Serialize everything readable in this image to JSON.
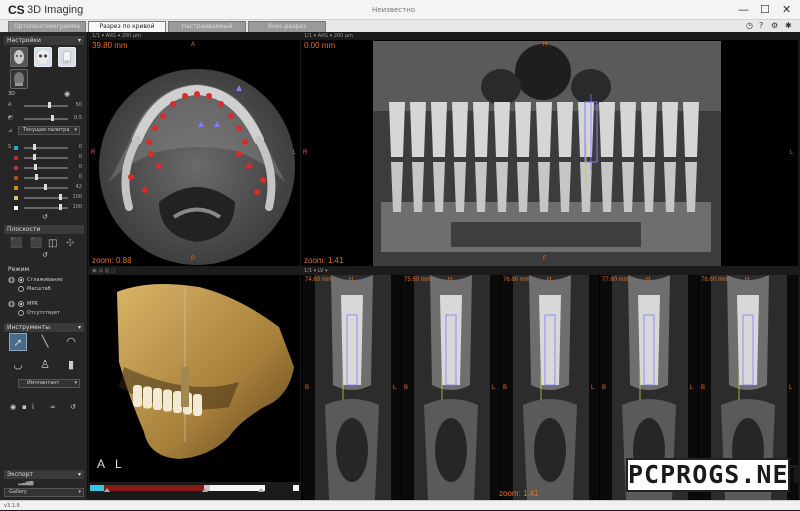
{
  "app": {
    "logo_bold": "CS",
    "logo_rest": "3D Imaging",
    "doc_title": "Неизвестно"
  },
  "window_controls": {
    "minimize": "—",
    "maximize": "☐",
    "close": "✕"
  },
  "tabs": [
    {
      "label": "Ортопантомограмма",
      "active": false
    },
    {
      "label": "Разрез по кривой",
      "active": true
    },
    {
      "label": "Настраиваемый толщиной",
      "active": false
    },
    {
      "label": "Вокс-разрез",
      "active": false
    }
  ],
  "toolbar_icons": [
    "clock-icon",
    "help-icon",
    "gears-icon",
    "settings-icon"
  ],
  "sidebar": {
    "settings_header": "Настройки",
    "preset_thumbs": [
      "head-front",
      "skull",
      "tooth",
      "head-dark"
    ],
    "sliders_main": [
      {
        "label": "3D",
        "value": "",
        "pos": 0.85,
        "color": ""
      },
      {
        "label": "A",
        "value": "50",
        "pos": 0.55,
        "color": ""
      },
      {
        "label": "",
        "value": "0.5",
        "pos": 0.62,
        "color": ""
      }
    ],
    "palette_label": "Текущая палитра",
    "sliders_palette": [
      {
        "label": "S",
        "value": "0",
        "pos": 0.2,
        "color": "#29a6d6"
      },
      {
        "label": "",
        "value": "0",
        "pos": 0.2,
        "color": "#b83030"
      },
      {
        "label": "",
        "value": "0",
        "pos": 0.22,
        "color": "#b83030"
      },
      {
        "label": "",
        "value": "0",
        "pos": 0.25,
        "color": "#b05020"
      },
      {
        "label": "",
        "value": "42",
        "pos": 0.45,
        "color": "#d08a20"
      },
      {
        "label": "",
        "value": "100",
        "pos": 0.8,
        "color": "#e0c070"
      },
      {
        "label": "",
        "value": "100",
        "pos": 0.8,
        "color": "#ffffff"
      }
    ],
    "views_header": "Плоскости",
    "mode_header": "Режим",
    "mode_options": [
      {
        "label": "Сглаживание",
        "on": true
      },
      {
        "label": "Масштаб",
        "on": false
      }
    ],
    "mpr_options": [
      {
        "label": "MPR",
        "on": true
      },
      {
        "label": "Отсутствует",
        "on": false
      }
    ],
    "tools_header": "Инструменты",
    "tool_selected": "Имплантант",
    "export_header": "Экспорт",
    "gallery_label": "Gallery"
  },
  "views": {
    "axial": {
      "dist": "39.80 mm",
      "zoom": "zoom: 0.88",
      "top": "A",
      "bottom": "P",
      "left": "R",
      "right": "L",
      "bar": "1/1  ▾  AVG  ▾  200 μm"
    },
    "pano": {
      "dist": "0.00 mm",
      "zoom": "zoom: 1.41",
      "top": "H",
      "bottom": "F",
      "left": "R",
      "right": "L",
      "bar": "1/1  ▾  AVG  ▾  200 μm"
    },
    "volume": {
      "left_label": "A",
      "right_label": "L",
      "bar": ""
    },
    "cross": {
      "bar": "1/1  ▾  LV  ▾",
      "zoom": "zoom: 1.41",
      "slices": [
        {
          "dist": "74.60 mm",
          "top": "H",
          "left": "B",
          "right": "L"
        },
        {
          "dist": "75.60 mm",
          "top": "H",
          "left": "B",
          "right": "L"
        },
        {
          "dist": "76.60 mm",
          "top": "H",
          "left": "B",
          "right": "L"
        },
        {
          "dist": "77.60 mm",
          "top": "H",
          "left": "B",
          "right": "L"
        },
        {
          "dist": "78.60 mm",
          "top": "H",
          "left": "B",
          "right": "L"
        }
      ]
    }
  },
  "status": {
    "version": "v3.1.9"
  },
  "watermark": "PCPROGS.NET",
  "colors": {
    "accent": "#e07020",
    "marker": "#d92b2b",
    "implant": "#7c7cff",
    "selected_tab": "#f7f7f7"
  }
}
